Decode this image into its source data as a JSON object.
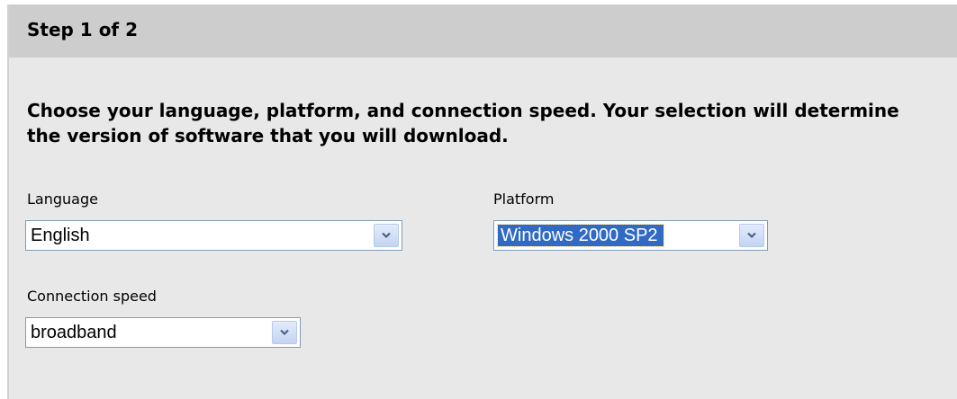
{
  "header": {
    "title": "Step 1 of 2"
  },
  "instructions": "Choose your language, platform, and connection speed. Your selection will determine the version of software that you will download.",
  "fields": {
    "language": {
      "label": "Language",
      "selected": "English",
      "icon": "chevron-down-icon"
    },
    "platform": {
      "label": "Platform",
      "selected": "Windows 2000 SP2",
      "icon": "chevron-down-icon"
    },
    "connection_speed": {
      "label": "Connection speed",
      "selected": "broadband",
      "icon": "chevron-down-icon"
    }
  },
  "colors": {
    "panel_background": "#e8e8e8",
    "header_background": "#cdcdcd",
    "selection_highlight": "#316ac5",
    "control_border": "#7f9db9"
  }
}
